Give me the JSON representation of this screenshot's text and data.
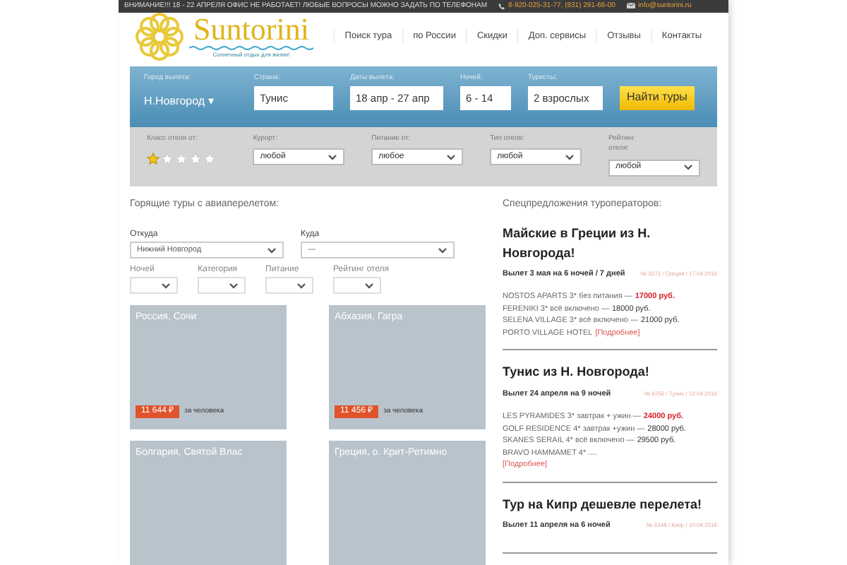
{
  "top_bar": {
    "notice": "ВНИМАНИЕ!!! 18 - 22 АПРЕЛЯ ОФИС НЕ РАБОТАЕТ! ЛЮБЫЕ ВОПРОСЫ МОЖНО ЗАДАТЬ ПО ТЕЛЕФОНАМ",
    "phones": "8-920-025-31-77, (831) 291-66-00",
    "email": "info@suntorini.ru"
  },
  "logo": {
    "name": "Suntorini",
    "tagline": "Солнечный отдых для жизни!"
  },
  "nav": [
    "Поиск тура",
    "по России",
    "Скидки",
    "Доп. сервисы",
    "Отзывы",
    "Контакты"
  ],
  "search": {
    "city_label": "Город вылета:",
    "city": "Н.Новгород",
    "city_caret": "▾",
    "fields": [
      {
        "label": "Страна:",
        "value": "Тунис"
      },
      {
        "label": "Даты вылета:",
        "value": "18 апр - 27 апр"
      },
      {
        "label": "Ночей:",
        "value": "6 - 14"
      },
      {
        "label": "Туристы:",
        "value": "2 взрослых"
      }
    ],
    "button": "Найти туры",
    "stars_label": "Класс отеля от:",
    "stars": 1,
    "selects": [
      {
        "label": "Курорт:",
        "value": "любой"
      },
      {
        "label": "Питание от:",
        "value": "любое"
      },
      {
        "label": "Тип отеля:",
        "value": "любой"
      },
      {
        "label": "Рейтинг отеля:",
        "value": "любой"
      }
    ]
  },
  "hot": {
    "title": "Горящие туры с авиаперелетом:",
    "from_label": "Откуда",
    "from": "Нижний Новгород",
    "to_label": "Куда",
    "to": "---",
    "filters": [
      "Ночей",
      "Категория",
      "Питание",
      "Рейтинг отеля"
    ],
    "cards": [
      {
        "title": "Россия, Сочи",
        "price": "11 644 ₽",
        "per": "за человека"
      },
      {
        "title": "Абхазия, Гагра",
        "price": "11 456 ₽",
        "per": "за человека"
      },
      {
        "title": "Болгария, Святой Влас"
      },
      {
        "title": "Греция, о. Крит-Ретимно"
      }
    ]
  },
  "offers": {
    "title": "Спецпредложения туроператоров:",
    "items": [
      {
        "heading": "Майские в Греции из Н. Новгорода!",
        "departure": "Вылет 3 мая на 6 ночей / 7 дней",
        "meta": "№ 6271 / Греция / 17.04.2016",
        "lines": [
          {
            "hotel": "NOSTOS APARTS 3* без питания —",
            "price": "17000 руб.",
            "highlight": true
          },
          {
            "hotel": "FERENIKI 3* всё включено —",
            "price": "18000 руб.",
            "highlight": false
          },
          {
            "hotel": "SELENA VILLAGE 3* всё включено —",
            "price": "21000 руб.",
            "highlight": false
          },
          {
            "hotel": "PORTO VILLAGE HOTEL",
            "more": "[Подробнее]"
          }
        ]
      },
      {
        "heading": "Тунис из Н. Новгорода!",
        "departure": "Вылет 24 апреля на 9 ночей",
        "meta": "№ 6256 / Тунис / 12.04.2016",
        "lines": [
          {
            "hotel": "LES PYRAMIDES 3* завтрак + ужин —",
            "price": "24000 руб.",
            "highlight": true
          },
          {
            "hotel": "GOLF RESIDENCE 4* завтрак +ужин —",
            "price": "28000 руб.",
            "highlight": false
          },
          {
            "hotel": "SKANES SERAIL 4* всё включено —",
            "price": "29500 руб.",
            "highlight": false
          },
          {
            "hotel": "BRAVO HAMMAMET 4* ...."
          },
          {
            "more": "[Подробнее]"
          }
        ]
      },
      {
        "heading": "Тур на Кипр дешевле перелета!",
        "departure": "Вылет 11 апреля на 6 ночей",
        "meta": "№ 6248 / Кипр / 10.04.2016"
      }
    ]
  }
}
